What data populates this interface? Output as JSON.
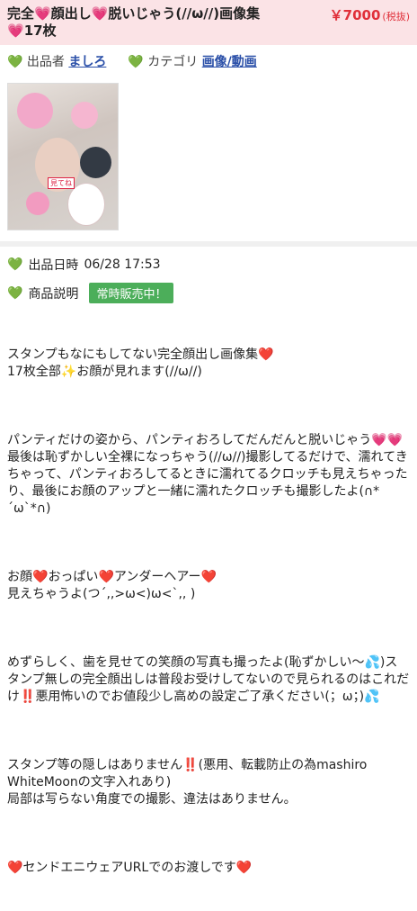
{
  "header": {
    "title_parts": [
      "完全",
      "顔出し",
      "脱いじゃう(//ω//)画像集",
      "17枚"
    ],
    "price": "￥7000",
    "tax": "(税抜)"
  },
  "meta": {
    "seller_label": "出品者",
    "seller_name": "ましろ",
    "category_label": "カテゴリ",
    "category_value": "画像/動画"
  },
  "thumbnail": {
    "sticker_text": "見てね"
  },
  "info": {
    "date_label": "出品日時",
    "date_value": "06/28 17:53",
    "desc_label": "商品説明",
    "badge": "常時販売中！"
  },
  "description": {
    "p1_a": "スタンプもなにもしてない完全顔出し画像集",
    "p1_b": "17枚全部",
    "p1_c": "お顔が見れます(//ω//)",
    "p2_a": "パンティだけの姿から、パンティおろしてだんだんと脱いじゃう",
    "p2_b": "最後は恥ずかしい全裸になっちゃう(//ω//)撮影してるだけで、濡れてきちゃって、パンティおろしてるときに濡れてるクロッチも見えちゃったり、最後にお顔のアップと一緒に濡れたクロッチも撮影したよ(∩*´ω`*∩)",
    "p3_a": "お顔",
    "p3_b": "おっぱい",
    "p3_c": "アンダーヘアー",
    "p3_d": "見えちゃうよ(つ´,,>ω<)ω<`,, )",
    "p4_a": "めずらしく、歯を見せての笑顔の写真も撮ったよ(恥ずかしい〜",
    "p4_b": ")スタンプ無しの完全顔出しは普段お受けしてないので見られるのはこれだけ",
    "p4_c": "悪用怖いのでお値段少し高めの設定ご了承ください(；ω；)",
    "p5_a": "スタンプ等の隠しはありません",
    "p5_b": "(悪用、転載防止の為mashiro WhiteMoonの文字入れあり)",
    "p5_c": "局部は写らない角度での撮影、違法はありません。",
    "p6_a": "センドエニウェアURLでのお渡しです"
  }
}
